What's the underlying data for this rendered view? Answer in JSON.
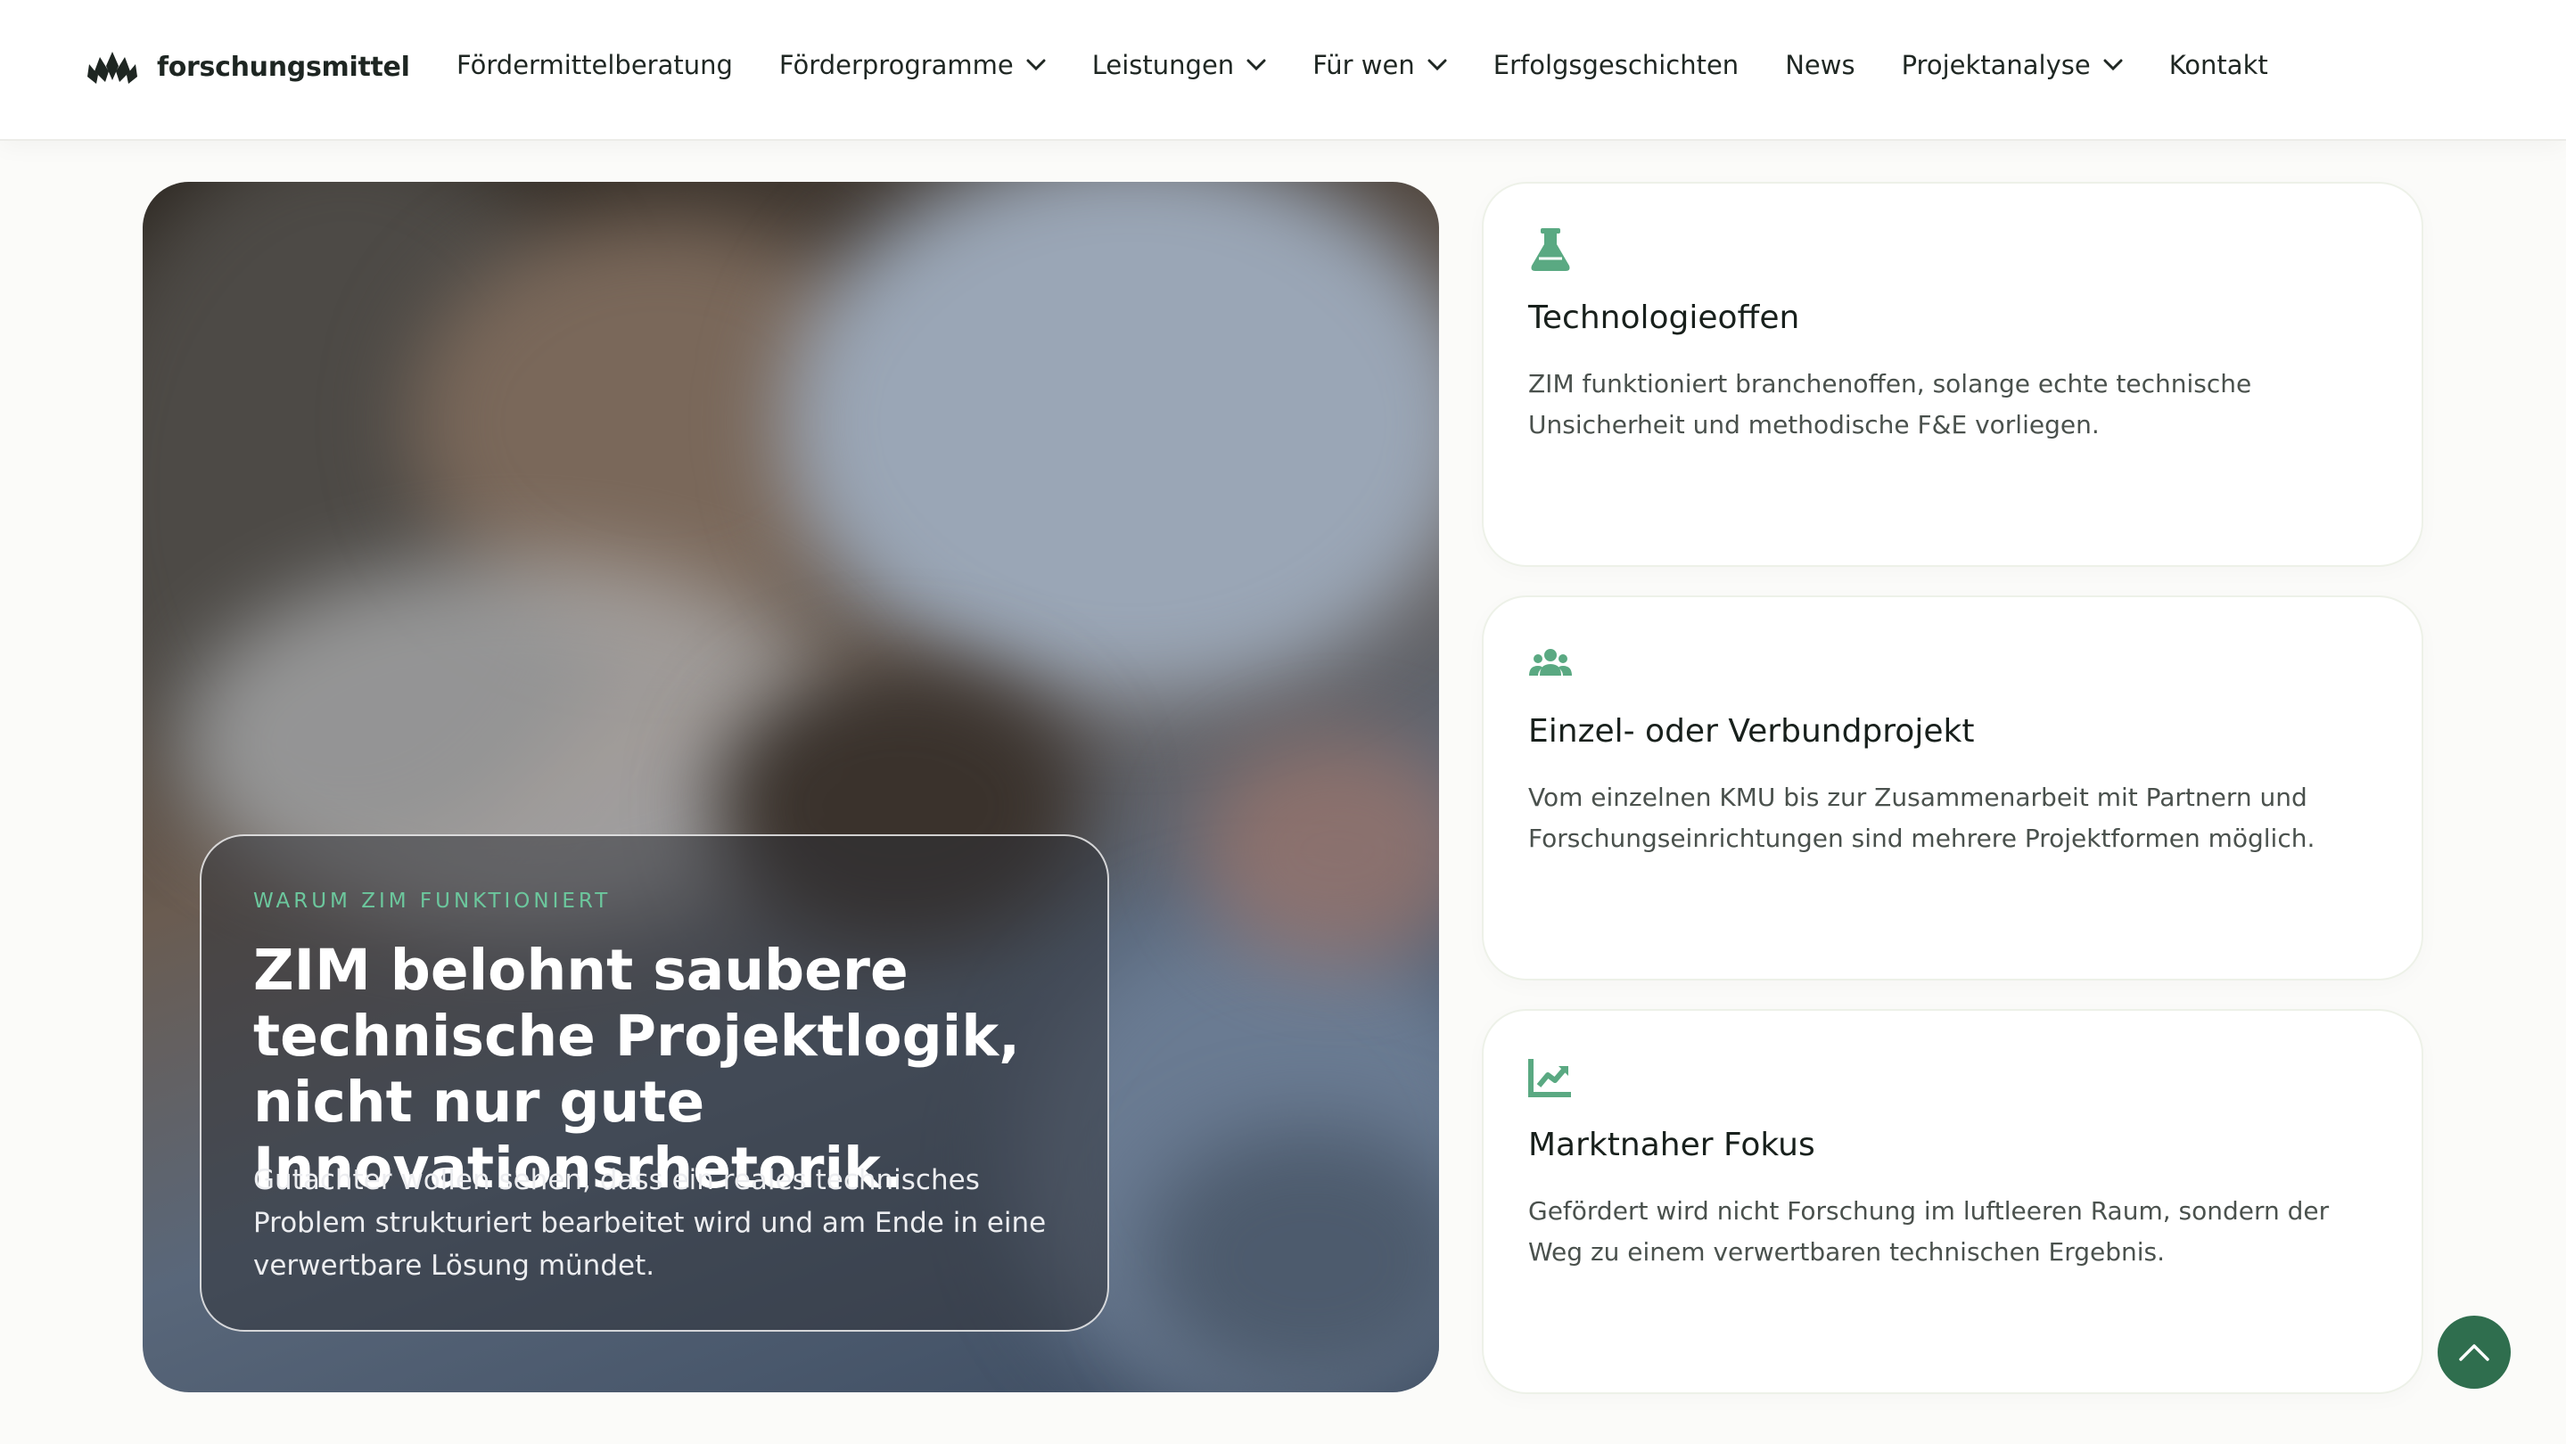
{
  "header": {
    "brand": "forschungsmittel",
    "logo_icon": "lotus-logo-icon",
    "nav": [
      {
        "label": "Fördermittelberatung",
        "dropdown": false
      },
      {
        "label": "Förderprogramme",
        "dropdown": true
      },
      {
        "label": "Leistungen",
        "dropdown": true
      },
      {
        "label": "Für wen",
        "dropdown": true
      },
      {
        "label": "Erfolgsgeschichten",
        "dropdown": false
      },
      {
        "label": "News",
        "dropdown": false
      },
      {
        "label": "Projektanalyse",
        "dropdown": true
      },
      {
        "label": "Kontakt",
        "dropdown": false
      }
    ]
  },
  "hero": {
    "eyebrow": "WARUM ZIM FUNKTIONIERT",
    "headline": "ZIM belohnt saubere technische Projektlogik, nicht nur gute Innovationsrhetorik.",
    "text": "Gutachter wollen sehen, dass ein reales technisches Problem strukturiert bearbeitet wird und am Ende in eine verwertbare Lösung mündet."
  },
  "cards": [
    {
      "icon": "flask-icon",
      "title": "Technologieoffen",
      "text": "ZIM funktioniert branchenoffen, solange echte technische Unsicherheit und methodische F&E vorliegen."
    },
    {
      "icon": "users-icon",
      "title": "Einzel- oder Verbundprojekt",
      "text": "Vom einzelnen KMU bis zur Zusammenarbeit mit Partnern und Forschungseinrichtungen sind mehrere Projektformen möglich."
    },
    {
      "icon": "chart-line-icon",
      "title": "Marktnaher Fokus",
      "text": "Gefördert wird nicht Forschung im luftleeren Raum, sondern der Weg zu einem verwertbaren technischen Ergebnis."
    }
  ],
  "scroll_top": {
    "icon": "chevron-up-icon"
  },
  "colors": {
    "accent": "#5aa982",
    "button": "#2f6e4e",
    "eyebrow": "#6cc79d"
  }
}
